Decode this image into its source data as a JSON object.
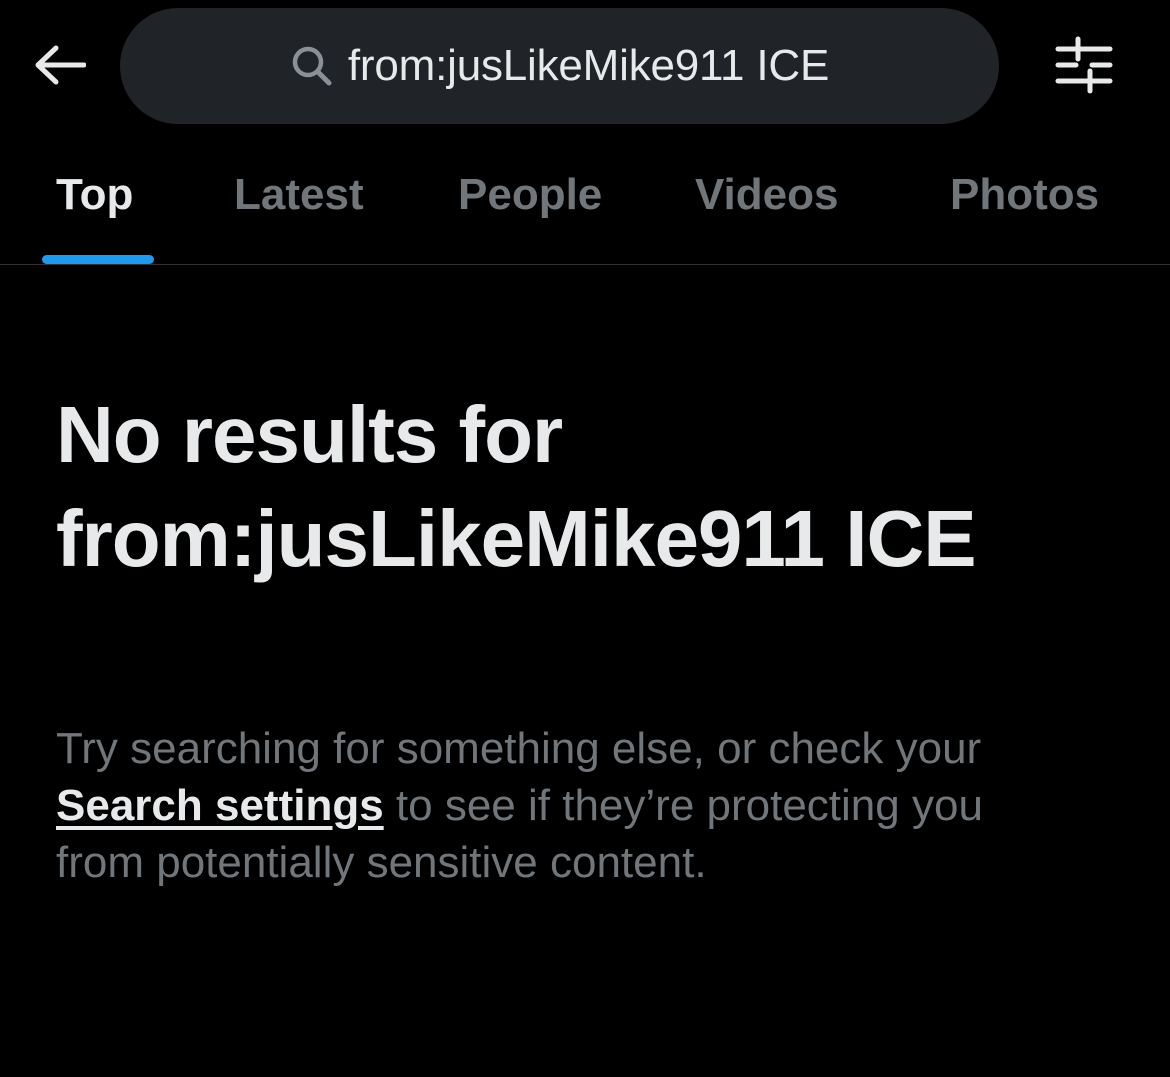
{
  "header": {
    "back_icon": "arrow-left-icon",
    "search": {
      "icon": "search-icon",
      "value": "from:jusLikeMike911 ICE"
    },
    "filter_icon": "sliders-icon"
  },
  "tabs": [
    {
      "label": "Top",
      "active": true
    },
    {
      "label": "Latest",
      "active": false
    },
    {
      "label": "People",
      "active": false
    },
    {
      "label": "Videos",
      "active": false
    },
    {
      "label": "Photos",
      "active": false
    }
  ],
  "empty_state": {
    "title": "No results for from:jusLikeMike911 ICE",
    "description_before": "Try searching for something else, or check your ",
    "link_label": "Search settings",
    "description_after": " to see if they’re protecting you from potentially sensitive content."
  },
  "colors": {
    "background": "#000000",
    "accent": "#1d9bf0",
    "primary_text": "#e7e9ea",
    "secondary_text": "#71767b",
    "search_field": "#202327"
  }
}
